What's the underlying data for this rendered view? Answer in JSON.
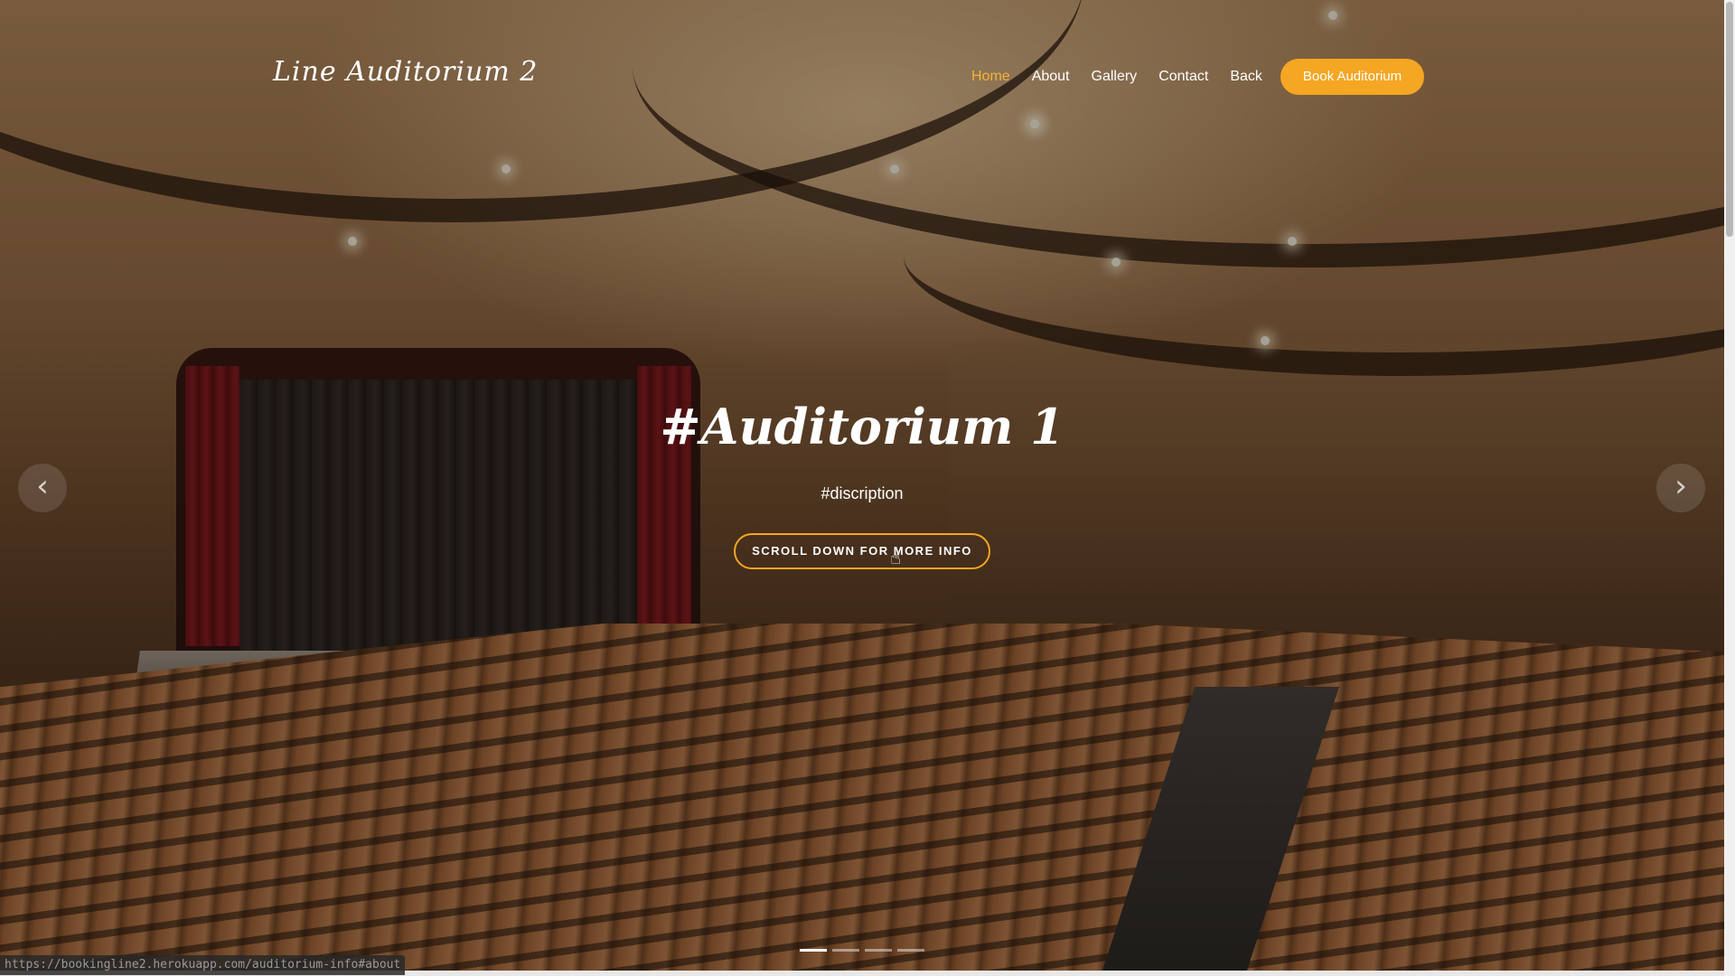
{
  "header": {
    "logo": "Line Auditorium 2",
    "nav": [
      "Home",
      "About",
      "Gallery",
      "Contact",
      "Back"
    ],
    "active_nav": "Home",
    "book_button": "Book Auditorium"
  },
  "slide": {
    "title": "#Auditorium 1",
    "description": "#discription",
    "button": "SCROLL DOWN FOR MORE INFO",
    "total_slides": 4,
    "active_slide": 1
  },
  "carousel": {
    "prev_icon": "chevron-left-icon",
    "next_icon": "chevron-right-icon",
    "prev_glyph": "‹",
    "next_glyph": "›"
  },
  "status": {
    "url": "https://bookingline2.herokuapp.com/auditorium-info#about"
  },
  "colors": {
    "accent": "#f5a623",
    "active_nav": "#f5b335",
    "text": "#ffffff"
  }
}
